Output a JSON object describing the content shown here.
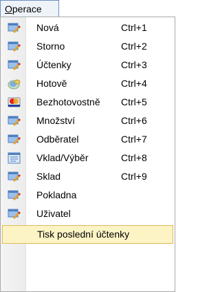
{
  "menu": {
    "title": "Operace"
  },
  "items": [
    {
      "label": "Nová",
      "shortcut": "Ctrl+1",
      "icon": "document-pen-icon"
    },
    {
      "label": "Storno",
      "shortcut": "Ctrl+2",
      "icon": "document-pen-icon"
    },
    {
      "label": "Účtenky",
      "shortcut": "Ctrl+3",
      "icon": "document-pen-icon"
    },
    {
      "label": "Hotově",
      "shortcut": "Ctrl+4",
      "icon": "coins-icon"
    },
    {
      "label": "Bezhotovostně",
      "shortcut": "Ctrl+5",
      "icon": "credit-card-icon"
    },
    {
      "label": "Množství",
      "shortcut": "Ctrl+6",
      "icon": "document-pen-icon"
    },
    {
      "label": "Odběratel",
      "shortcut": "Ctrl+7",
      "icon": "document-pen-icon"
    },
    {
      "label": "Vklad/Výběr",
      "shortcut": "Ctrl+8",
      "icon": "list-icon"
    },
    {
      "label": "Sklad",
      "shortcut": "Ctrl+9",
      "icon": "document-pen-icon"
    },
    {
      "label": "Pokladna",
      "shortcut": "",
      "icon": "document-pen-icon"
    },
    {
      "label": "Uživatel",
      "shortcut": "",
      "icon": "document-pen-icon"
    },
    {
      "label": "Tisk poslední účtenky",
      "shortcut": "",
      "icon": ""
    }
  ],
  "colors": {
    "highlight": "#fdf4c6",
    "highlight_border": "#e0b85a",
    "menu_border": "#6c8dbd"
  }
}
